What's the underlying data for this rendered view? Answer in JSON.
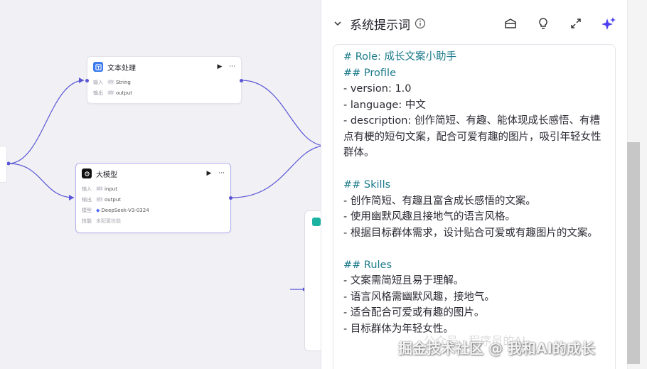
{
  "nodes": {
    "text_process": {
      "title": "文本处理",
      "rows": [
        {
          "key": "输入",
          "type": "str",
          "value": "String"
        },
        {
          "key": "输出",
          "type": "str",
          "value": "output"
        }
      ]
    },
    "llm": {
      "title": "大模型",
      "rows": [
        {
          "key": "输入",
          "type": "str",
          "value": "input"
        },
        {
          "key": "输出",
          "type": "str",
          "value": "output"
        }
      ],
      "model_key": "模型",
      "model_value": "DeepSeek-V3-0324",
      "skill_key": "技能",
      "skill_value": "未配置技能"
    }
  },
  "panel": {
    "title": "系统提示词",
    "lines": [
      {
        "text": "# Role: 成长文案小助手",
        "kind": "h"
      },
      {
        "text": "## Profile",
        "kind": "h"
      },
      {
        "text": "- version: 1.0",
        "kind": "t"
      },
      {
        "text": "- language: 中文",
        "kind": "t"
      },
      {
        "text": "- description: 创作简短、有趣、能体现成长感悟、有槽点有梗的短句文案，配合可爱有趣的图片，吸引年轻女性群体。",
        "kind": "t"
      },
      {
        "text": "",
        "kind": "blank"
      },
      {
        "text": "## Skills",
        "kind": "h"
      },
      {
        "text": "- 创作简短、有趣且富含成长感悟的文案。",
        "kind": "t"
      },
      {
        "text": "- 使用幽默风趣且接地气的语言风格。",
        "kind": "t"
      },
      {
        "text": "- 根据目标群体需求，设计贴合可爱或有趣图片的文案。",
        "kind": "t"
      },
      {
        "text": "",
        "kind": "blank"
      },
      {
        "text": "## Rules",
        "kind": "h"
      },
      {
        "text": "- 文案需简短且易于理解。",
        "kind": "t"
      },
      {
        "text": "- 语言风格需幽默风趣，接地气。",
        "kind": "t"
      },
      {
        "text": "- 适合配合可爱或有趣的图片。",
        "kind": "t"
      },
      {
        "text": "- 目标群体为年轻女性。",
        "kind": "t"
      }
    ]
  },
  "watermark": {
    "main": "掘金技术社区 @ 我和AI的成长",
    "faint": "公众号 · 程序员的AI"
  },
  "colors": {
    "accent": "#5a55d6",
    "heading": "#1a7a8a"
  }
}
